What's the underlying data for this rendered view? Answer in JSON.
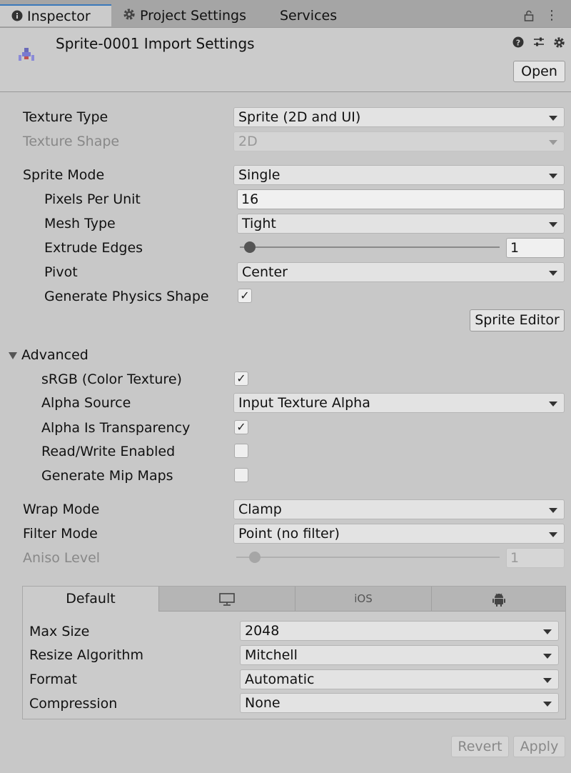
{
  "tabs": [
    {
      "label": "Inspector",
      "icon": "info-icon",
      "active": true
    },
    {
      "label": "Project Settings",
      "icon": "gear-icon",
      "active": false
    },
    {
      "label": "Services",
      "icon": "",
      "active": false
    }
  ],
  "header": {
    "title": "Sprite-0001 Import Settings",
    "open_label": "Open"
  },
  "settings": {
    "texture_type": {
      "label": "Texture Type",
      "value": "Sprite (2D and UI)"
    },
    "texture_shape": {
      "label": "Texture Shape",
      "value": "2D"
    },
    "sprite_mode": {
      "label": "Sprite Mode",
      "value": "Single"
    },
    "pixels_per_unit": {
      "label": "Pixels Per Unit",
      "value": "16"
    },
    "mesh_type": {
      "label": "Mesh Type",
      "value": "Tight"
    },
    "extrude_edges": {
      "label": "Extrude Edges",
      "value": "1"
    },
    "pivot": {
      "label": "Pivot",
      "value": "Center"
    },
    "generate_physics_shape": {
      "label": "Generate Physics Shape",
      "checked": true
    },
    "sprite_editor_label": "Sprite Editor"
  },
  "advanced": {
    "label": "Advanced",
    "srgb": {
      "label": "sRGB (Color Texture)",
      "checked": true
    },
    "alpha_source": {
      "label": "Alpha Source",
      "value": "Input Texture Alpha"
    },
    "alpha_is_transparency": {
      "label": "Alpha Is Transparency",
      "checked": true
    },
    "read_write": {
      "label": "Read/Write Enabled",
      "checked": false
    },
    "mip_maps": {
      "label": "Generate Mip Maps",
      "checked": false
    }
  },
  "sampling": {
    "wrap_mode": {
      "label": "Wrap Mode",
      "value": "Clamp"
    },
    "filter_mode": {
      "label": "Filter Mode",
      "value": "Point (no filter)"
    },
    "aniso_level": {
      "label": "Aniso Level",
      "value": "1"
    }
  },
  "platform": {
    "tabs": [
      {
        "label": "Default",
        "icon": ""
      },
      {
        "label": "",
        "icon": "monitor-icon"
      },
      {
        "label": "iOS",
        "icon": ""
      },
      {
        "label": "",
        "icon": "android-icon"
      }
    ],
    "max_size": {
      "label": "Max Size",
      "value": "2048"
    },
    "resize_algorithm": {
      "label": "Resize Algorithm",
      "value": "Mitchell"
    },
    "format": {
      "label": "Format",
      "value": "Automatic"
    },
    "compression": {
      "label": "Compression",
      "value": "None"
    }
  },
  "footer": {
    "revert_label": "Revert",
    "apply_label": "Apply"
  }
}
